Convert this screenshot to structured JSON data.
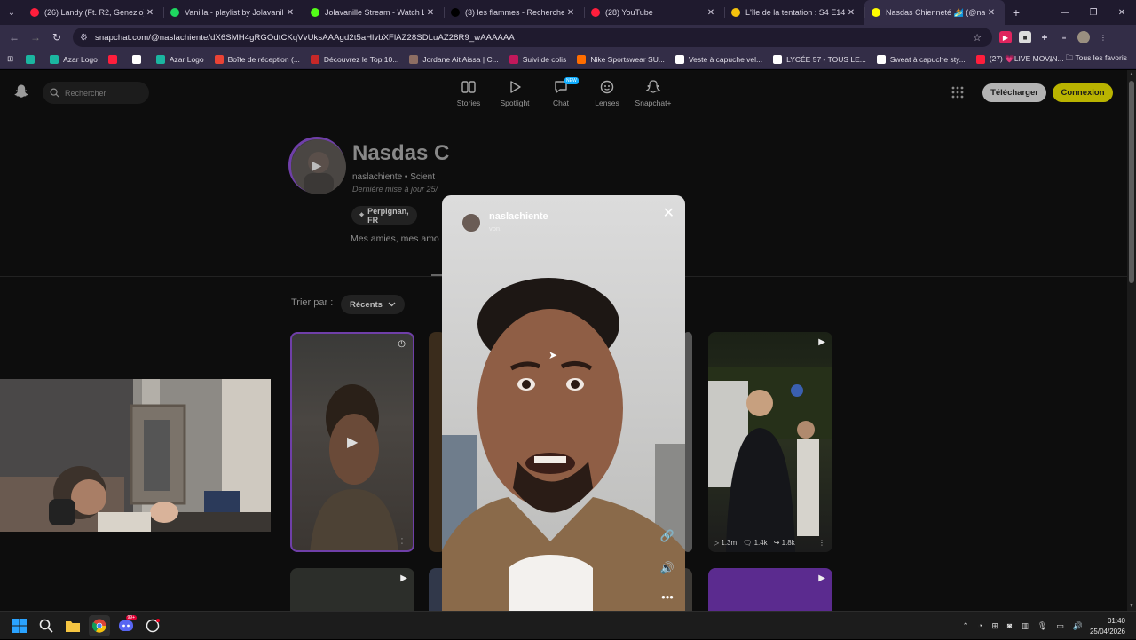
{
  "browser": {
    "tabs": [
      {
        "title": "(26) Landy (Ft. R2, Genezio) - R",
        "icon_color": "#ff1e3c",
        "icon": "youtube-icon"
      },
      {
        "title": "Vanilla - playlist by Jolavanille",
        "icon_color": "#1ed760",
        "icon": "spotify-icon"
      },
      {
        "title": "Jolavanille Stream - Watch Live",
        "icon_color": "#53fc18",
        "icon": "kick-icon"
      },
      {
        "title": "(3) les flammes - Recherche / X",
        "icon_color": "#000000",
        "icon": "x-icon"
      },
      {
        "title": "(28) YouTube",
        "icon_color": "#ff1e3c",
        "icon": "youtube-icon"
      },
      {
        "title": "L'île de la tentation : S4 E14 (2/",
        "icon_color": "#f4c20d",
        "icon": "tv-icon"
      },
      {
        "title": "Nasdas Chienneté 🏄 (@na",
        "icon_color": "#fffc00",
        "icon": "snapchat-icon",
        "active": true
      }
    ],
    "url": "snapchat.com/@naslachiente/dX6SMH4gRGOdtCKqVvUksAAAgd2t5aHlvbXFlAZ28SDLuAZ28R9_wAAAAAA",
    "bookmarks": [
      {
        "label": "",
        "color": "#1bb6a0"
      },
      {
        "label": "Azar Logo",
        "color": "#1bb6a0"
      },
      {
        "label": "",
        "color": "#ff1e3c"
      },
      {
        "label": "",
        "color": "#ffffff"
      },
      {
        "label": "Azar Logo",
        "color": "#1bb6a0"
      },
      {
        "label": "Boîte de réception (...",
        "color": "#ea4335"
      },
      {
        "label": "Découvrez le Top 10...",
        "color": "#c62828"
      },
      {
        "label": "Jordane Ait Aissa | C...",
        "color": "#8d6e63"
      },
      {
        "label": "Suivi de colis",
        "color": "#c2185b"
      },
      {
        "label": "Nike Sportswear SU...",
        "color": "#ff6d00"
      },
      {
        "label": "Veste à capuche vel...",
        "color": "#ffffff"
      },
      {
        "label": "LYCÉE 57 - TOUS LE...",
        "color": "#ffffff"
      },
      {
        "label": "Sweat à capuche sty...",
        "color": "#ffffff"
      },
      {
        "label": "(27) 💗LIVE MOVIN...",
        "color": "#ff1e3c"
      }
    ],
    "bookmarks_more": "»",
    "all_bookmarks": "Tous les favoris"
  },
  "snapchat": {
    "search_placeholder": "Rechercher",
    "nav": [
      {
        "label": "Stories",
        "icon": "stories-icon"
      },
      {
        "label": "Spotlight",
        "icon": "spotlight-icon"
      },
      {
        "label": "Chat",
        "icon": "chat-icon",
        "badge": "NEW"
      },
      {
        "label": "Lenses",
        "icon": "lenses-icon"
      },
      {
        "label": "Snapchat+",
        "icon": "snapchat-plus-icon"
      }
    ],
    "download_label": "Télécharger",
    "login_label": "Connexion",
    "accent_color": "#b9b300"
  },
  "profile": {
    "name": "Nasdas C",
    "subtitle": "naslachiente • Scient",
    "updated": "Dernière mise à jour 25/",
    "location": "Perpignan, FR",
    "bio": "Mes amies, mes amo"
  },
  "sort": {
    "label": "Trier par :",
    "value": "Récents"
  },
  "spotlight_stats": {
    "views": "1.3m",
    "comments": "1.4k",
    "shares": "1.8k"
  },
  "modal": {
    "username": "naslachiente",
    "subtitle": "von."
  },
  "taskbar": {
    "time": "01:40",
    "date": "25/04/2026",
    "discord_badge": "99+"
  }
}
